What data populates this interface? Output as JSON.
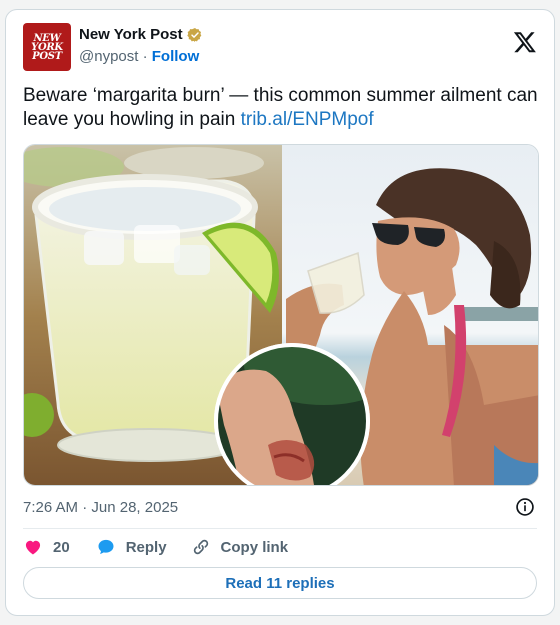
{
  "author": {
    "name": "New York Post",
    "handle": "@nypost",
    "separator": "·",
    "follow_label": "Follow",
    "logo_lines": [
      "NEW",
      "YORK",
      "POST"
    ]
  },
  "post": {
    "text": "Beware ‘margarita burn’ — this common summer ailment can leave you howling in pain ",
    "link": "trib.al/ENPMpof"
  },
  "meta": {
    "time": "7:26 AM",
    "separator": "·",
    "date": "Jun 28, 2025"
  },
  "actions": {
    "like_count": "20",
    "reply_label": "Reply",
    "copy_link_label": "Copy link"
  },
  "read_replies_label": "Read 11 replies",
  "icons": {
    "verified": "verified-badge-icon",
    "platform": "x-logo-icon",
    "info": "info-icon",
    "like": "heart-icon",
    "reply": "speech-bubble-icon",
    "copy": "link-icon"
  },
  "colors": {
    "accent": "#1d6fb8",
    "heart": "#f91880",
    "brand": "#b01a1a"
  }
}
